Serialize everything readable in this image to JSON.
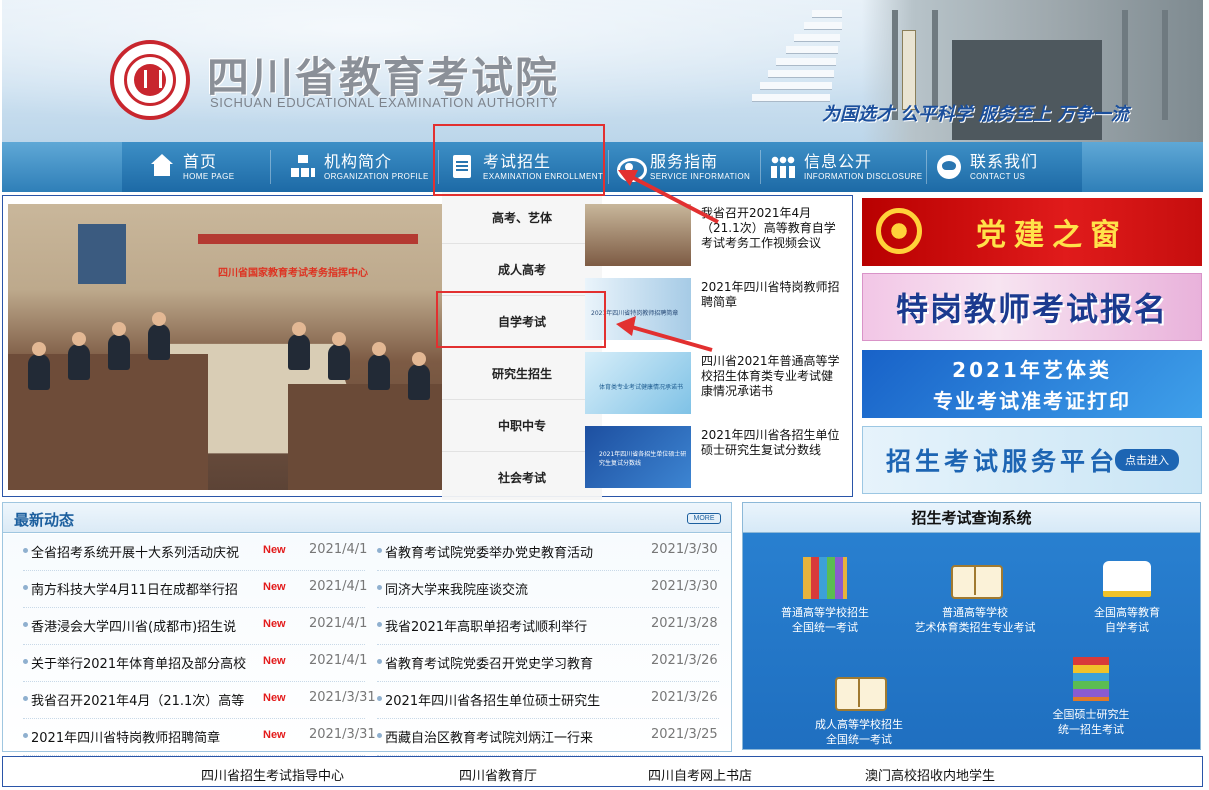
{
  "header": {
    "title_cn": "四川省教育考试院",
    "title_en": "SICHUAN EDUCATIONAL EXAMINATION AUTHORITY",
    "slogan": "为国选才  公平科学  服务至上  万争一流"
  },
  "nav": {
    "items": [
      {
        "cn": "首页",
        "en": "HOME PAGE",
        "icon": "home-icon"
      },
      {
        "cn": "机构简介",
        "en": "ORGANIZATION PROFILE",
        "icon": "org-chart-icon"
      },
      {
        "cn": "考试招生",
        "en": "EXAMINATION ENROLLMENT",
        "icon": "exam-doc-icon"
      },
      {
        "cn": "服务指南",
        "en": "SERVICE INFORMATION",
        "icon": "service-icon"
      },
      {
        "cn": "信息公开",
        "en": "INFORMATION DISCLOSURE",
        "icon": "info-people-icon"
      },
      {
        "cn": "联系我们",
        "en": "CONTACT US",
        "icon": "contact-icon"
      }
    ]
  },
  "dropdown": {
    "items": [
      "高考、艺体",
      "成人高考",
      "自学考试",
      "研究生招生",
      "中职中专",
      "社会考试"
    ]
  },
  "feature": {
    "photo_banner": "四川省国家教育考试考务指挥中心",
    "news": [
      {
        "title": "我省召开2021年4月（21.1次）高等教育自学考试考务工作视频会议"
      },
      {
        "title": "2021年四川省特岗教师招聘简章",
        "thumb_text": "2021年四川省特岗教师招聘简章"
      },
      {
        "title": "四川省2021年普通高等学校招生体育类专业考试健康情况承诺书",
        "thumb_text": "体育类专业考试健康情况承诺书"
      },
      {
        "title": "2021年四川省各招生单位硕士研究生复试分数线",
        "thumb_text": "2021年四川省各招生单位硕士研究生复试分数线"
      }
    ]
  },
  "promos": {
    "party": "党建之窗",
    "teacher": "特岗教师考试报名",
    "art_line1": "2021年艺体类",
    "art_line2": "专业考试准考证打印",
    "platform": "招生考试服务平台",
    "platform_btn": "点击进入"
  },
  "latest": {
    "title": "最新动态",
    "more": "MORE",
    "left": [
      {
        "title": "全省招考系统开展十大系列活动庆祝",
        "new": "New",
        "date": "2021/4/1"
      },
      {
        "title": "南方科技大学4月11日在成都举行招",
        "new": "New",
        "date": "2021/4/1"
      },
      {
        "title": "香港浸会大学四川省(成都市)招生说",
        "new": "New",
        "date": "2021/4/1"
      },
      {
        "title": "关于举行2021年体育单招及部分高校",
        "new": "New",
        "date": "2021/4/1"
      },
      {
        "title": "我省召开2021年4月（21.1次）高等",
        "new": "New",
        "date": "2021/3/31"
      },
      {
        "title": "2021年四川省特岗教师招聘简章",
        "new": "New",
        "date": "2021/3/31"
      }
    ],
    "right": [
      {
        "title": "省教育考试院党委举办党史教育活动",
        "date": "2021/3/30"
      },
      {
        "title": "同济大学来我院座谈交流",
        "date": "2021/3/30"
      },
      {
        "title": "我省2021年高职单招考试顺利举行",
        "date": "2021/3/28"
      },
      {
        "title": "省教育考试院党委召开党史学习教育",
        "date": "2021/3/26"
      },
      {
        "title": "2021年四川省各招生单位硕士研究生",
        "date": "2021/3/26"
      },
      {
        "title": "西藏自治区教育考试院刘炳江一行来",
        "date": "2021/3/25"
      }
    ]
  },
  "query": {
    "title": "招生考试查询系统",
    "items": [
      {
        "line1": "普通高等学校招生",
        "line2": "全国统一考试"
      },
      {
        "line1": "普通高等学校",
        "line2": "艺术体育类招生专业考试"
      },
      {
        "line1": "全国高等教育",
        "line2": "自学考试"
      },
      {
        "line1": "成人高等学校招生",
        "line2": "全国统一考试"
      },
      {
        "line1": "全国硕士研究生",
        "line2": "统一招生考试"
      }
    ]
  },
  "footer": {
    "links": [
      "四川省招生考试指导中心",
      "四川省教育厅",
      "四川自考网上书店",
      "澳门高校招收内地学生"
    ]
  },
  "colors": {
    "nav_blue": "#2f7fb8",
    "annotation_red": "#e23030",
    "new_red": "#e31b1b",
    "title_blue": "#1c5f9e"
  }
}
